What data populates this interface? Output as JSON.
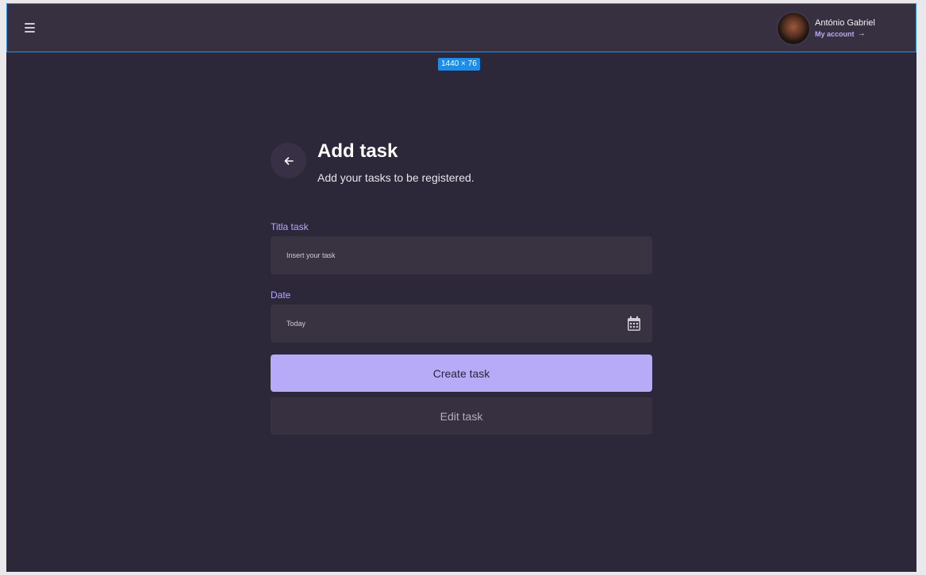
{
  "header": {
    "user_name": "António Gabriel",
    "account_link": "My account",
    "account_arrow": "→"
  },
  "frame_badge": "1440 × 76",
  "page": {
    "title": "Add task",
    "subtitle": "Add your tasks to be registered."
  },
  "form": {
    "title_label": "Titla task",
    "title_placeholder": "Insert your task",
    "date_label": "Date",
    "date_value": "Today"
  },
  "actions": {
    "create_label": "Create task",
    "edit_label": "Edit task"
  },
  "colors": {
    "background": "#2d2839",
    "surface": "#393241",
    "accent": "#b7abf8",
    "label": "#b8a9f7"
  },
  "icons": {
    "menu": "menu-icon",
    "back": "arrow-left-icon",
    "calendar": "calendar-icon",
    "account_arrow": "arrow-right-icon"
  }
}
